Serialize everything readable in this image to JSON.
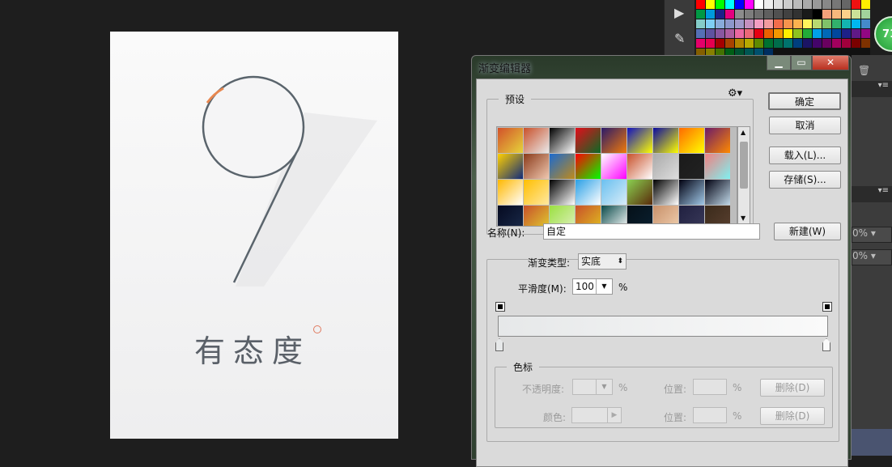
{
  "poster": {
    "text": "有态度"
  },
  "badge": {
    "value": "71"
  },
  "right_panel": {
    "pct1": "0%",
    "pct2": "0%"
  },
  "dialog": {
    "title": "渐变编辑器",
    "presets_label": "预设",
    "buttons": {
      "ok": "确定",
      "cancel": "取消",
      "load": "载入(L)...",
      "save": "存储(S)...",
      "new": "新建(W)"
    },
    "name_label": "名称(N):",
    "name_value": "自定",
    "type_label": "渐变类型:",
    "type_value": "实底",
    "smooth_label": "平滑度(M):",
    "smooth_value": "100",
    "percent": "%",
    "gradient": {
      "from": "#e6e8e9",
      "to": "#fafafa"
    },
    "stops": {
      "legend": "色标",
      "opacity_label": "不透明度:",
      "color_label": "颜色:",
      "location_label": "位置:",
      "delete_label": "删除(D)"
    },
    "presets": [
      [
        "#d2512b",
        "#e6d33a"
      ],
      [
        "#c9502a",
        "#e9e9e9"
      ],
      [
        "#000000",
        "#ffffff"
      ],
      [
        "#e30d1b",
        "#0a6a25"
      ],
      [
        "#2a1a6a",
        "#f07a0a"
      ],
      [
        "#1010c0",
        "#ffff00"
      ],
      [
        "#0a0aa0",
        "#ffff00"
      ],
      [
        "#ff6a00",
        "#ffff00"
      ],
      [
        "#6a1a6a",
        "#ff8a00"
      ],
      [
        "#ffd000",
        "#102a7a"
      ],
      [
        "#8a3a1a",
        "#f0c8b0"
      ],
      [
        "#1a6ad0",
        "#c08a1a"
      ],
      [
        "#ff0000",
        "#00ff00"
      ],
      [
        "#ffffff",
        "#ff00ff"
      ],
      [
        "#c8502a",
        "#ffffff"
      ],
      [
        "#aaaaaa",
        "#dddddd"
      ],
      [
        "#1a1a1a",
        "#222222"
      ],
      [
        "#f08080",
        "#80f0f0"
      ],
      [
        "#ffb800",
        "#ffffff"
      ],
      [
        "#ffbe00",
        "#ffe8a0"
      ],
      [
        "#000000",
        "#ffffff"
      ],
      [
        "#2aa0e6",
        "#ffffff"
      ],
      [
        "#6ac0f0",
        "#d8ecf8"
      ],
      [
        "#8ad050",
        "#5a2a0a"
      ],
      [
        "#000000",
        "#ffffff"
      ],
      [
        "#000010",
        "#a0c8e8"
      ],
      [
        "#000010",
        "#c0d8e8"
      ],
      [
        "#050a20",
        "#1a2a4a"
      ],
      [
        "#c8502a",
        "#e0d030"
      ],
      [
        "#9ae040",
        "#e0f0c0"
      ],
      [
        "#c8502a",
        "#e0c020"
      ],
      [
        "#0a4a4a",
        "#ffffff"
      ],
      [
        "#051018",
        "#0a2030"
      ],
      [
        "#c8906a",
        "#f0d0b0"
      ],
      [
        "#202040",
        "#3a3a5a"
      ],
      [
        "#3a2a1a",
        "#5a4030"
      ]
    ],
    "palette": [
      "#ff0000",
      "#ffff00",
      "#00ff00",
      "#00ffff",
      "#0000ff",
      "#ff00ff",
      "#ffffff",
      "#eeeeee",
      "#dddddd",
      "#cccccc",
      "#bbbbbb",
      "#aaaaaa",
      "#999999",
      "#888888",
      "#777777",
      "#666666",
      "#ee1111",
      "#ffee00",
      "#009944",
      "#0099dd",
      "#1d2088",
      "#e4007f",
      "#8c8c8c",
      "#7d7d7d",
      "#6e6e6e",
      "#5f5f5f",
      "#505050",
      "#414141",
      "#323232",
      "#1a1a1a",
      "#000000",
      "#f4a07a",
      "#f8b87c",
      "#fcd08a",
      "#cce198",
      "#a2d39c",
      "#84ccc9",
      "#7ecef4",
      "#88abda",
      "#8c97cb",
      "#a099c9",
      "#c490bf",
      "#f29ec2",
      "#f29c9f",
      "#f26d4b",
      "#f7944d",
      "#fbb24f",
      "#fff45c",
      "#b9d870",
      "#80c269",
      "#32b16c",
      "#13b5b1",
      "#00b7ee",
      "#448aca",
      "#556fb5",
      "#5f52a0",
      "#8957a1",
      "#ae5da1",
      "#ea68a2",
      "#eb6877",
      "#e60012",
      "#eb6100",
      "#f39800",
      "#fff100",
      "#8fc31f",
      "#22ac38",
      "#00a0e9",
      "#0068b7",
      "#00479d",
      "#1d2088",
      "#601986",
      "#920783",
      "#e5006a",
      "#e5004f",
      "#a40000",
      "#a84200",
      "#b28500",
      "#b7aa00",
      "#5f8a00",
      "#007130",
      "#006c4b",
      "#00736d",
      "#003f7f",
      "#1b1464",
      "#44046a",
      "#6a005f",
      "#a2005e",
      "#a1003c",
      "#7b0000",
      "#7e3100",
      "#845f00",
      "#877f00",
      "#437200",
      "#005e15",
      "#005230",
      "#005652",
      "#00506d",
      "#002e60"
    ]
  }
}
